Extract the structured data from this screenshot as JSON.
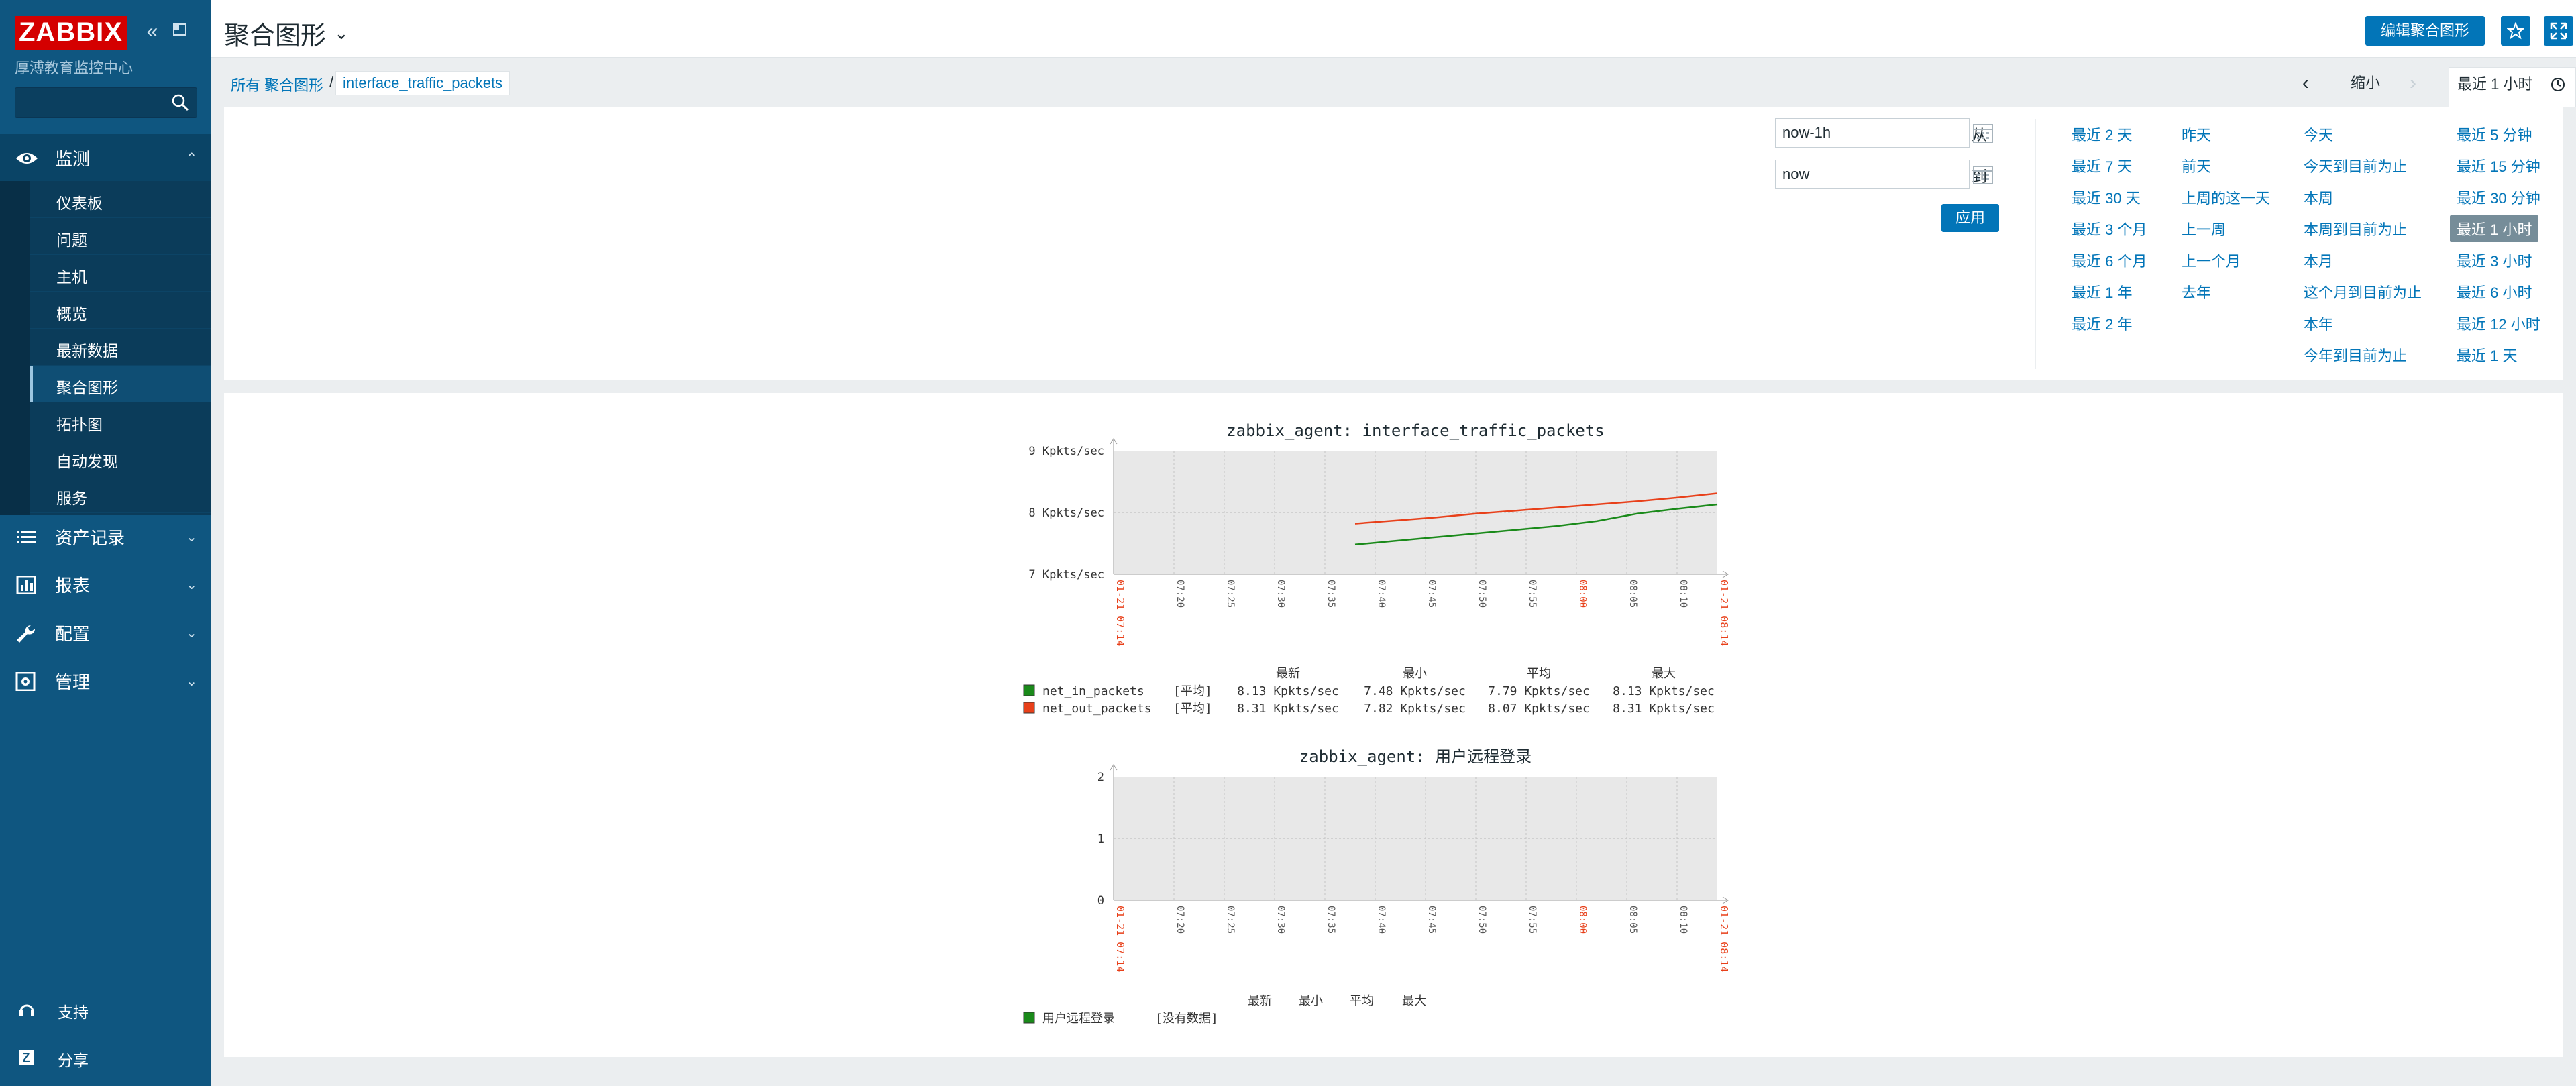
{
  "sidebar": {
    "brand": "ZABBIX",
    "subtitle": "厚溥教育监控中心",
    "search_value": "",
    "menu": [
      {
        "label": "监测",
        "icon": "eye-icon",
        "expanded": true
      },
      {
        "label": "资产记录",
        "icon": "list-icon"
      },
      {
        "label": "报表",
        "icon": "bar-chart-icon"
      },
      {
        "label": "配置",
        "icon": "wrench-icon"
      },
      {
        "label": "管理",
        "icon": "gear-icon"
      }
    ],
    "submenu": [
      "仪表板",
      "问题",
      "主机",
      "概览",
      "最新数据",
      "聚合图形",
      "拓扑图",
      "自动发现",
      "服务"
    ],
    "active_submenu": "聚合图形",
    "footer": [
      {
        "label": "支持",
        "icon": "headset-icon"
      },
      {
        "label": "分享",
        "icon": "share-icon"
      }
    ]
  },
  "header": {
    "title": "聚合图形",
    "edit_button": "编辑聚合图形"
  },
  "breadcrumb": {
    "all": "所有 聚合图形",
    "separator": "/",
    "current": "interface_traffic_packets"
  },
  "time_nav": {
    "zoom_out": "缩小",
    "tab_label": "最近 1 小时"
  },
  "filter": {
    "from_label": "自从",
    "from_value": "now-1h",
    "to_label": "到",
    "to_value": "now",
    "apply": "应用",
    "quick_columns": [
      [
        "最近 2 天",
        "最近 7 天",
        "最近 30 天",
        "最近 3 个月",
        "最近 6 个月",
        "最近 1 年",
        "最近 2 年"
      ],
      [
        "昨天",
        "前天",
        "上周的这一天",
        "上一周",
        "上一个月",
        "去年"
      ],
      [
        "今天",
        "今天到目前为止",
        "本周",
        "本周到目前为止",
        "本月",
        "这个月到目前为止",
        "本年",
        "今年到目前为止"
      ],
      [
        "最近 5 分钟",
        "最近 15 分钟",
        "最近 30 分钟",
        "最近 1 小时",
        "最近 3 小时",
        "最近 6 小时",
        "最近 12 小时",
        "最近 1 天"
      ]
    ],
    "selected": "最近 1 小时"
  },
  "chart_data": [
    {
      "type": "line",
      "title": "zabbix_agent: interface_traffic_packets",
      "y_ticks": [
        "9 Kpkts/sec",
        "8 Kpkts/sec",
        "7 Kpkts/sec"
      ],
      "ylim": [
        7,
        9
      ],
      "x_start_label": "01-21 07:14",
      "x_end_label": "01-21 08:14",
      "x_ticks": [
        "07:20",
        "07:25",
        "07:30",
        "07:35",
        "07:40",
        "07:45",
        "07:50",
        "07:55",
        "08:00",
        "08:05",
        "08:10"
      ],
      "x_ticks_red": [
        "08:00"
      ],
      "x_range_minutes": [
        0,
        60
      ],
      "series": [
        {
          "name": "net_in_packets",
          "color": "#1a8a1a",
          "func": "[平均]",
          "last": "8.13 Kpkts/sec",
          "min": "7.48 Kpkts/sec",
          "avg": "7.79 Kpkts/sec",
          "max": "8.13 Kpkts/sec",
          "x": [
            24,
            28,
            32,
            36,
            40,
            44,
            48,
            52,
            56,
            60
          ],
          "values": [
            7.48,
            7.54,
            7.6,
            7.66,
            7.72,
            7.78,
            7.86,
            7.98,
            8.06,
            8.13
          ]
        },
        {
          "name": "net_out_packets",
          "color": "#e8401a",
          "func": "[平均]",
          "last": "8.31 Kpkts/sec",
          "min": "7.82 Kpkts/sec",
          "avg": "8.07 Kpkts/sec",
          "max": "8.31 Kpkts/sec",
          "x": [
            24,
            28,
            32,
            36,
            40,
            44,
            48,
            52,
            56,
            60
          ],
          "values": [
            7.82,
            7.87,
            7.92,
            7.98,
            8.03,
            8.08,
            8.13,
            8.18,
            8.24,
            8.31
          ]
        }
      ],
      "legend_headers": [
        "最新",
        "最小",
        "平均",
        "最大"
      ]
    },
    {
      "type": "line",
      "title": "zabbix_agent: 用户远程登录",
      "y_ticks": [
        "2",
        "1",
        "0"
      ],
      "ylim": [
        0,
        2
      ],
      "x_start_label": "01-21 07:14",
      "x_end_label": "01-21 08:14",
      "x_ticks": [
        "07:20",
        "07:25",
        "07:30",
        "07:35",
        "07:40",
        "07:45",
        "07:50",
        "07:55",
        "08:00",
        "08:05",
        "08:10"
      ],
      "x_ticks_red": [
        "08:00"
      ],
      "x_range_minutes": [
        0,
        60
      ],
      "series": [
        {
          "name": "用户远程登录",
          "color": "#1a8a1a",
          "func": "[没有数据]",
          "x": [],
          "values": []
        }
      ],
      "legend_headers": [
        "最新",
        "最小",
        "平均",
        "最大"
      ]
    }
  ]
}
